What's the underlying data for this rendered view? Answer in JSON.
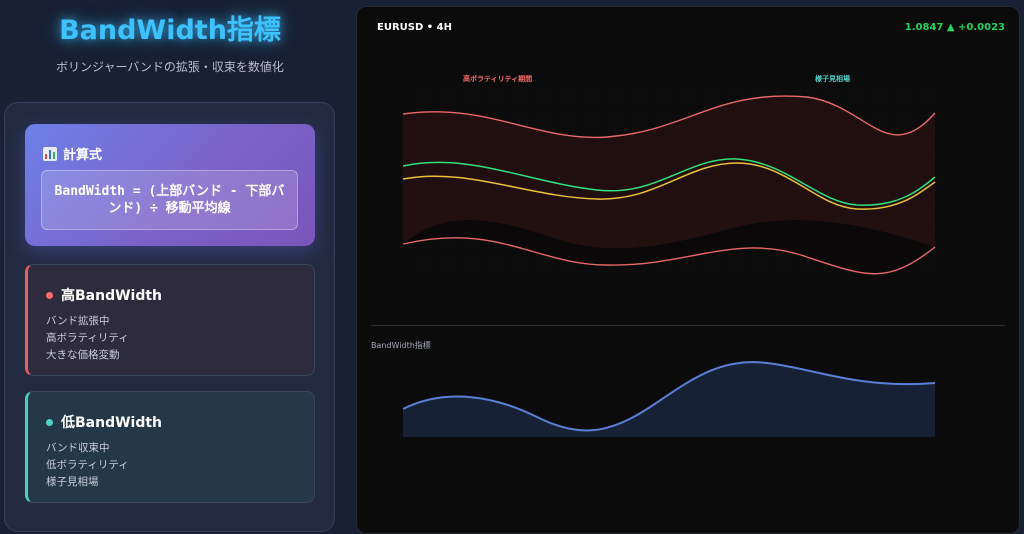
{
  "header": {
    "title": "BandWidth指標",
    "subtitle": "ボリンジャーバンドの拡張・収束を数値化"
  },
  "formula": {
    "heading": "計算式",
    "icon": "bar-chart-icon",
    "text": "BandWidth = (上部バンド - 下部バンド) ÷ 移動平均線"
  },
  "cards": {
    "high": {
      "title": "高BandWidth",
      "lines": [
        "バンド拡張中",
        "高ボラティリティ",
        "大きな価格変動"
      ],
      "color": "#ff6b6b"
    },
    "low": {
      "title": "低BandWidth",
      "lines": [
        "バンド収束中",
        "低ボラティリティ",
        "様子見相場"
      ],
      "color": "#4fd1c5"
    }
  },
  "chart": {
    "symbol": "EURUSD • 4H",
    "price": "1.0847 ▲ +0.0023",
    "label_high": "高ボラティリティ期間",
    "label_range": "様子見相場",
    "bw_label": "BandWidth指標",
    "colors": {
      "band": "#e86868",
      "price": "#2fe27a",
      "ma": "#e9c23a",
      "bandwidth": "#5b7fd6"
    }
  }
}
